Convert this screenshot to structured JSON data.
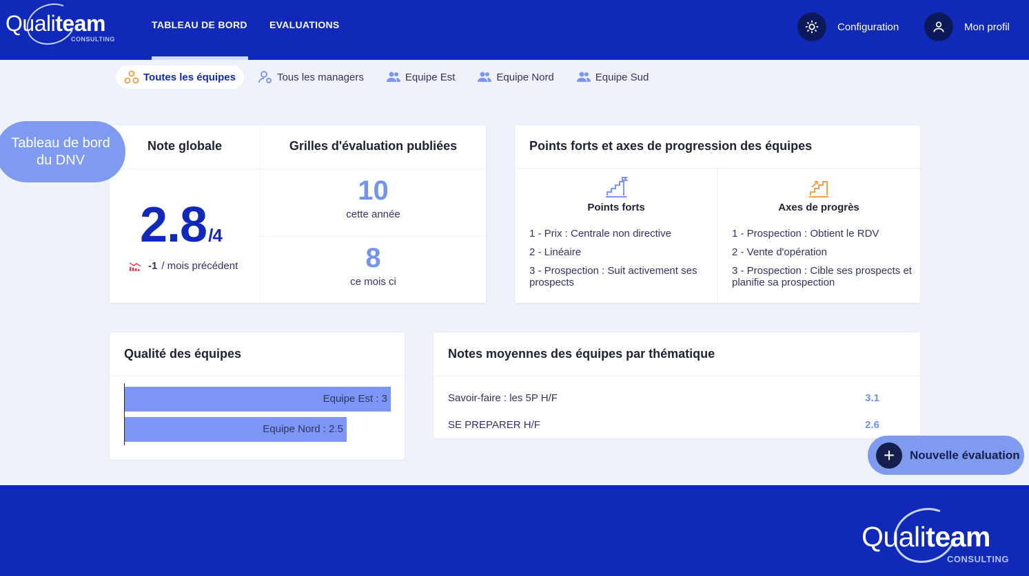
{
  "brand": {
    "name_light": "Quali",
    "name_bold": "team",
    "sub": "CONSULTING"
  },
  "nav": {
    "tabs": [
      {
        "label": "TABLEAU DE BORD",
        "active": true
      },
      {
        "label": "EVALUATIONS",
        "active": false
      }
    ],
    "configuration_label": "Configuration",
    "profile_label": "Mon profil"
  },
  "subtabs": [
    {
      "label": "Toutes les équipes",
      "active": true
    },
    {
      "label": "Tous les managers"
    },
    {
      "label": "Equipe Est"
    },
    {
      "label": "Equipe Nord"
    },
    {
      "label": "Equipe Sud"
    }
  ],
  "bubble": {
    "text": "Tableau de bord du DNV"
  },
  "note_globale": {
    "title": "Note globale",
    "score": "2.8",
    "denominator": "/4",
    "trend_value": "-1",
    "trend_label": "/ mois précédent"
  },
  "grilles": {
    "title": "Grilles d'évaluation publiées",
    "year_value": "10",
    "year_label": "cette année",
    "month_value": "8",
    "month_label": "ce mois ci"
  },
  "points": {
    "title": "Points forts et axes de progression des équipes",
    "forts_title": "Points forts",
    "forts": [
      "1 - Prix : Centrale non directive",
      "2 - Linéaire",
      "3 - Prospection : Suit activement ses prospects"
    ],
    "axes_title": "Axes de progrès",
    "axes": [
      "1 - Prospection : Obtient le RDV",
      "2 - Vente d'opération",
      "3 - Prospection : Cible ses prospects et planifie sa prospection"
    ]
  },
  "qualite": {
    "title": "Qualité des équipes",
    "bars": [
      {
        "label": "Equipe Est : 3",
        "value": 3
      },
      {
        "label": "Equipe Nord : 2.5",
        "value": 2.5
      }
    ],
    "max": 3
  },
  "thematique": {
    "title": "Notes moyennes des équipes par thématique",
    "rows": [
      {
        "label": "Savoir-faire : les 5P H/F",
        "value": "3.1"
      },
      {
        "label": "SE PREPARER H/F",
        "value": "2.6"
      }
    ]
  },
  "fab": {
    "label": "Nouvelle évaluation"
  },
  "colors": {
    "primary": "#1029b8",
    "accent": "#7e9bf0",
    "bar": "#7d96f5",
    "value": "#6f8ff0"
  }
}
